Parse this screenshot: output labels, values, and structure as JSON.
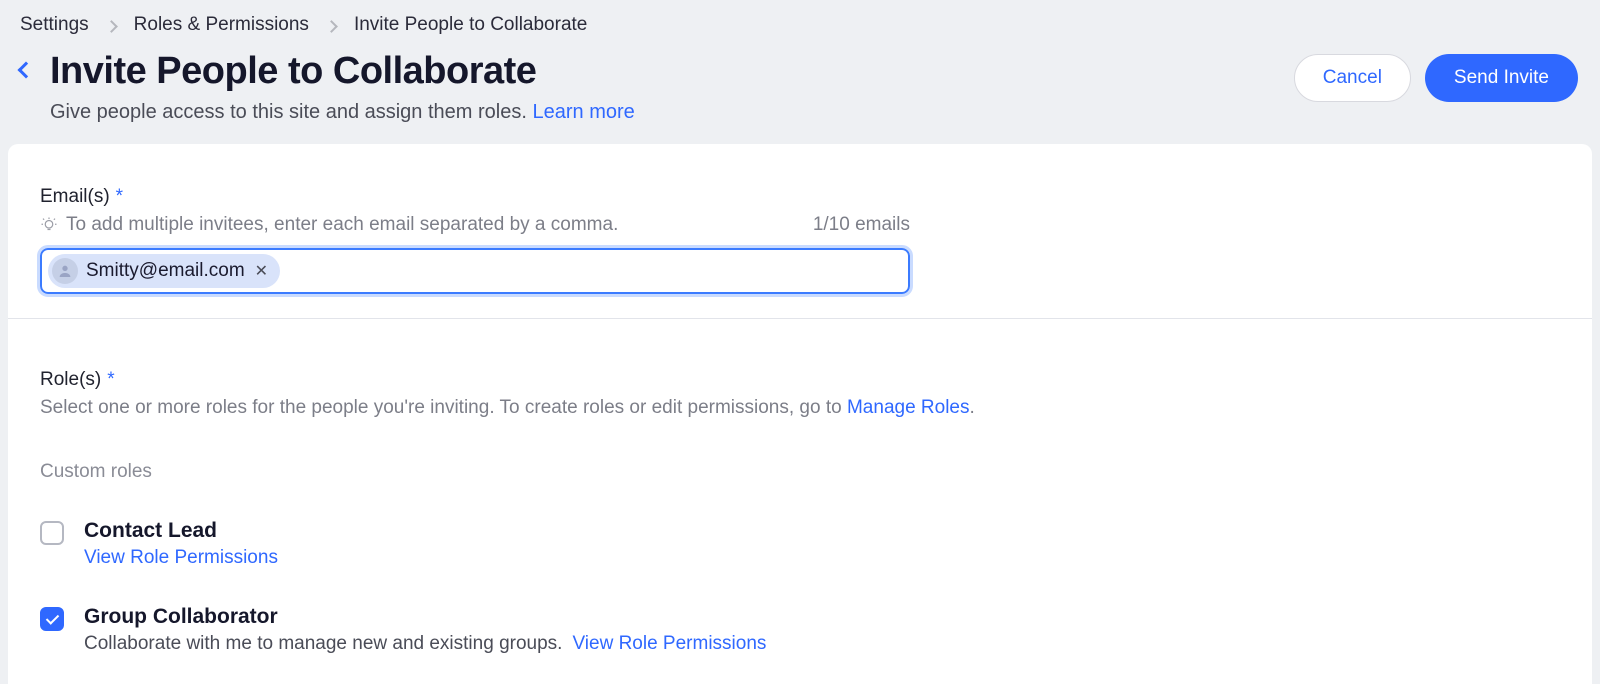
{
  "breadcrumb": {
    "items": [
      "Settings",
      "Roles & Permissions",
      "Invite People to Collaborate"
    ]
  },
  "header": {
    "title": "Invite People to Collaborate",
    "subtitle_prefix": "Give people access to this site and assign them roles. ",
    "learn_more": "Learn more",
    "cancel": "Cancel",
    "send": "Send Invite"
  },
  "emails": {
    "label": "Email(s)",
    "hint": "To add multiple invitees, enter each email separated by a comma.",
    "count": "1/10 emails",
    "tags": [
      "Smitty@email.com"
    ]
  },
  "roles": {
    "label": "Role(s)",
    "help_prefix": "Select one or more roles for the people you're inviting. To create roles or edit permissions, go to ",
    "manage_link": "Manage Roles",
    "help_suffix": ".",
    "custom_head": "Custom roles",
    "items": [
      {
        "name": "Contact Lead",
        "desc": "",
        "view_link": "View Role Permissions",
        "checked": false
      },
      {
        "name": "Group Collaborator",
        "desc": "Collaborate with me to manage new and existing groups.",
        "view_link": "View Role Permissions",
        "checked": true
      }
    ]
  }
}
